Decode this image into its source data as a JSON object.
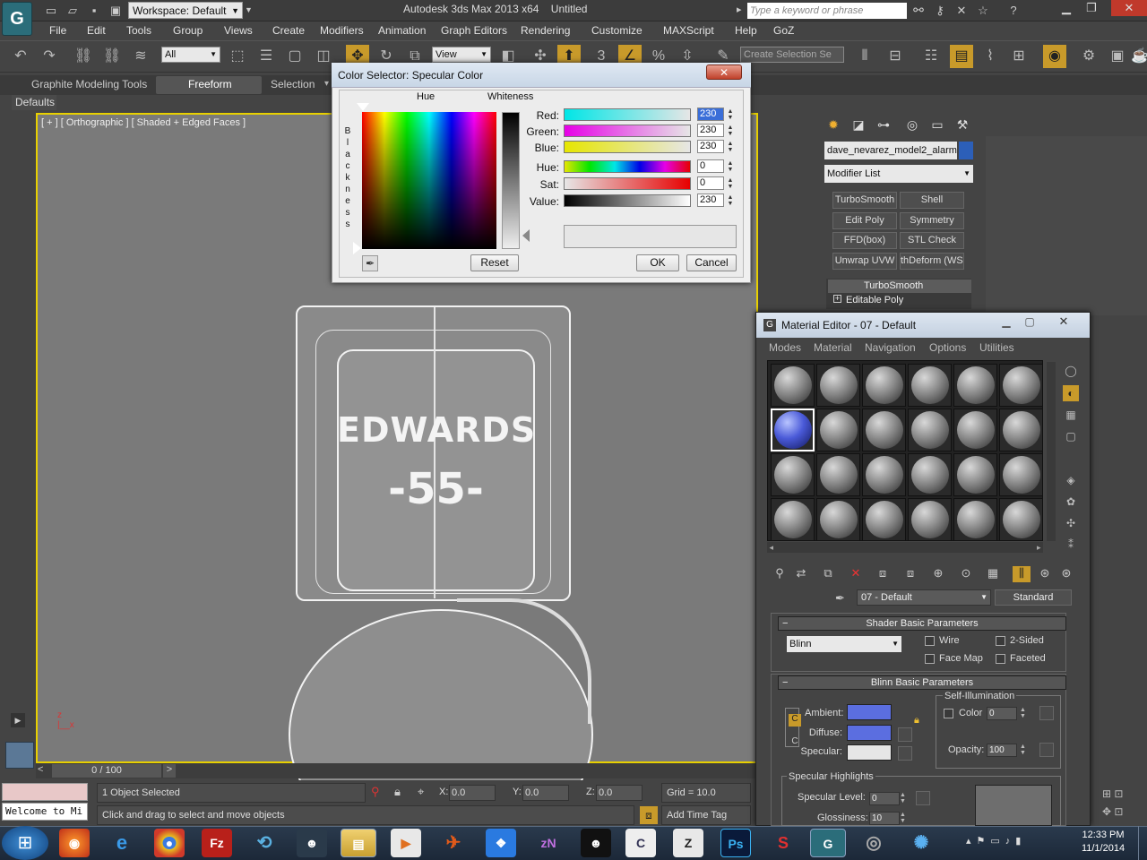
{
  "app": {
    "title": "Autodesk 3ds Max  2013 x64",
    "file": "Untitled",
    "workspace": "Workspace: Default",
    "search_placeholder": "Type a keyword or phrase",
    "logo": "G"
  },
  "menu": [
    "File",
    "Edit",
    "Tools",
    "Group",
    "Views",
    "Create",
    "Modifiers",
    "Animation",
    "Graph Editors",
    "Rendering",
    "Customize",
    "MAXScript",
    "Help",
    "GoZ"
  ],
  "toolbar": {
    "filter": "All",
    "coord": "View",
    "selection_set_placeholder": "Create Selection Se",
    "snap_value": "3"
  },
  "ribbon": {
    "tabs": [
      "Graphite Modeling Tools",
      "Freeform",
      "Selection"
    ],
    "active_tab": "Freeform",
    "defaults": "Defaults"
  },
  "viewport": {
    "label": "[ + ] [ Orthographic ] [ Shaded + Edged Faces ]",
    "model_text_1": "EDWARDS",
    "model_text_2": "-55-"
  },
  "timeline": {
    "frame": "0 / 100"
  },
  "status": {
    "selected": "1 Object Selected",
    "hint": "Click and drag to select and move objects",
    "x": "0.0",
    "y": "0.0",
    "z": "0.0",
    "grid": "Grid = 10.0",
    "add_time_tag": "Add Time Tag",
    "listener": "Welcome to Mi",
    "x_label": "X:",
    "y_label": "Y:",
    "z_label": "Z:"
  },
  "command_panel": {
    "object_name": "dave_nevarez_model2_alarm",
    "modifier_list": "Modifier List",
    "buttons": [
      "TurboSmooth",
      "Shell",
      "Edit Poly",
      "Symmetry",
      "FFD(box)",
      "STL Check",
      "Unwrap UVW",
      "thDeform (WSI"
    ],
    "stack": [
      "TurboSmooth",
      "Editable Poly"
    ],
    "colors": {
      "object": "#2c5fb8"
    }
  },
  "color_selector": {
    "title": "Color Selector: Specular Color",
    "hue_label": "Hue",
    "whiteness_label": "Whiteness",
    "blackness_label": "Blackness",
    "sliders": [
      {
        "label": "Red:",
        "value": "230"
      },
      {
        "label": "Green:",
        "value": "230"
      },
      {
        "label": "Blue:",
        "value": "230"
      },
      {
        "label": "Hue:",
        "value": "0"
      },
      {
        "label": "Sat:",
        "value": "0"
      },
      {
        "label": "Value:",
        "value": "230"
      }
    ],
    "reset": "Reset",
    "ok": "OK",
    "cancel": "Cancel",
    "current_color": "#e6e6e6"
  },
  "material_editor": {
    "title": "Material Editor - 07 - Default",
    "menu": [
      "Modes",
      "Material",
      "Navigation",
      "Options",
      "Utilities"
    ],
    "material_name": "07 - Default",
    "material_type": "Standard",
    "shader_rollout": "Shader Basic Parameters",
    "shader": "Blinn",
    "wire": "Wire",
    "two_sided": "2-Sided",
    "face_map": "Face Map",
    "faceted": "Faceted",
    "blinn_rollout": "Blinn Basic Parameters",
    "self_illum": "Self-Illumination",
    "color_label": "Color",
    "color_value": "0",
    "ambient": "Ambient:",
    "diffuse": "Diffuse:",
    "specular": "Specular:",
    "opacity_label": "Opacity:",
    "opacity_value": "100",
    "spec_highlights": "Specular Highlights",
    "spec_level_label": "Specular Level:",
    "spec_level_value": "0",
    "glossiness_label": "Glossiness:",
    "glossiness_value": "10",
    "colors": {
      "ambient": "#5b6ee0",
      "diffuse": "#5b6ee0",
      "specular": "#e6e6e6"
    }
  },
  "taskbar": {
    "time": "12:33 PM",
    "date": "11/1/2014"
  }
}
